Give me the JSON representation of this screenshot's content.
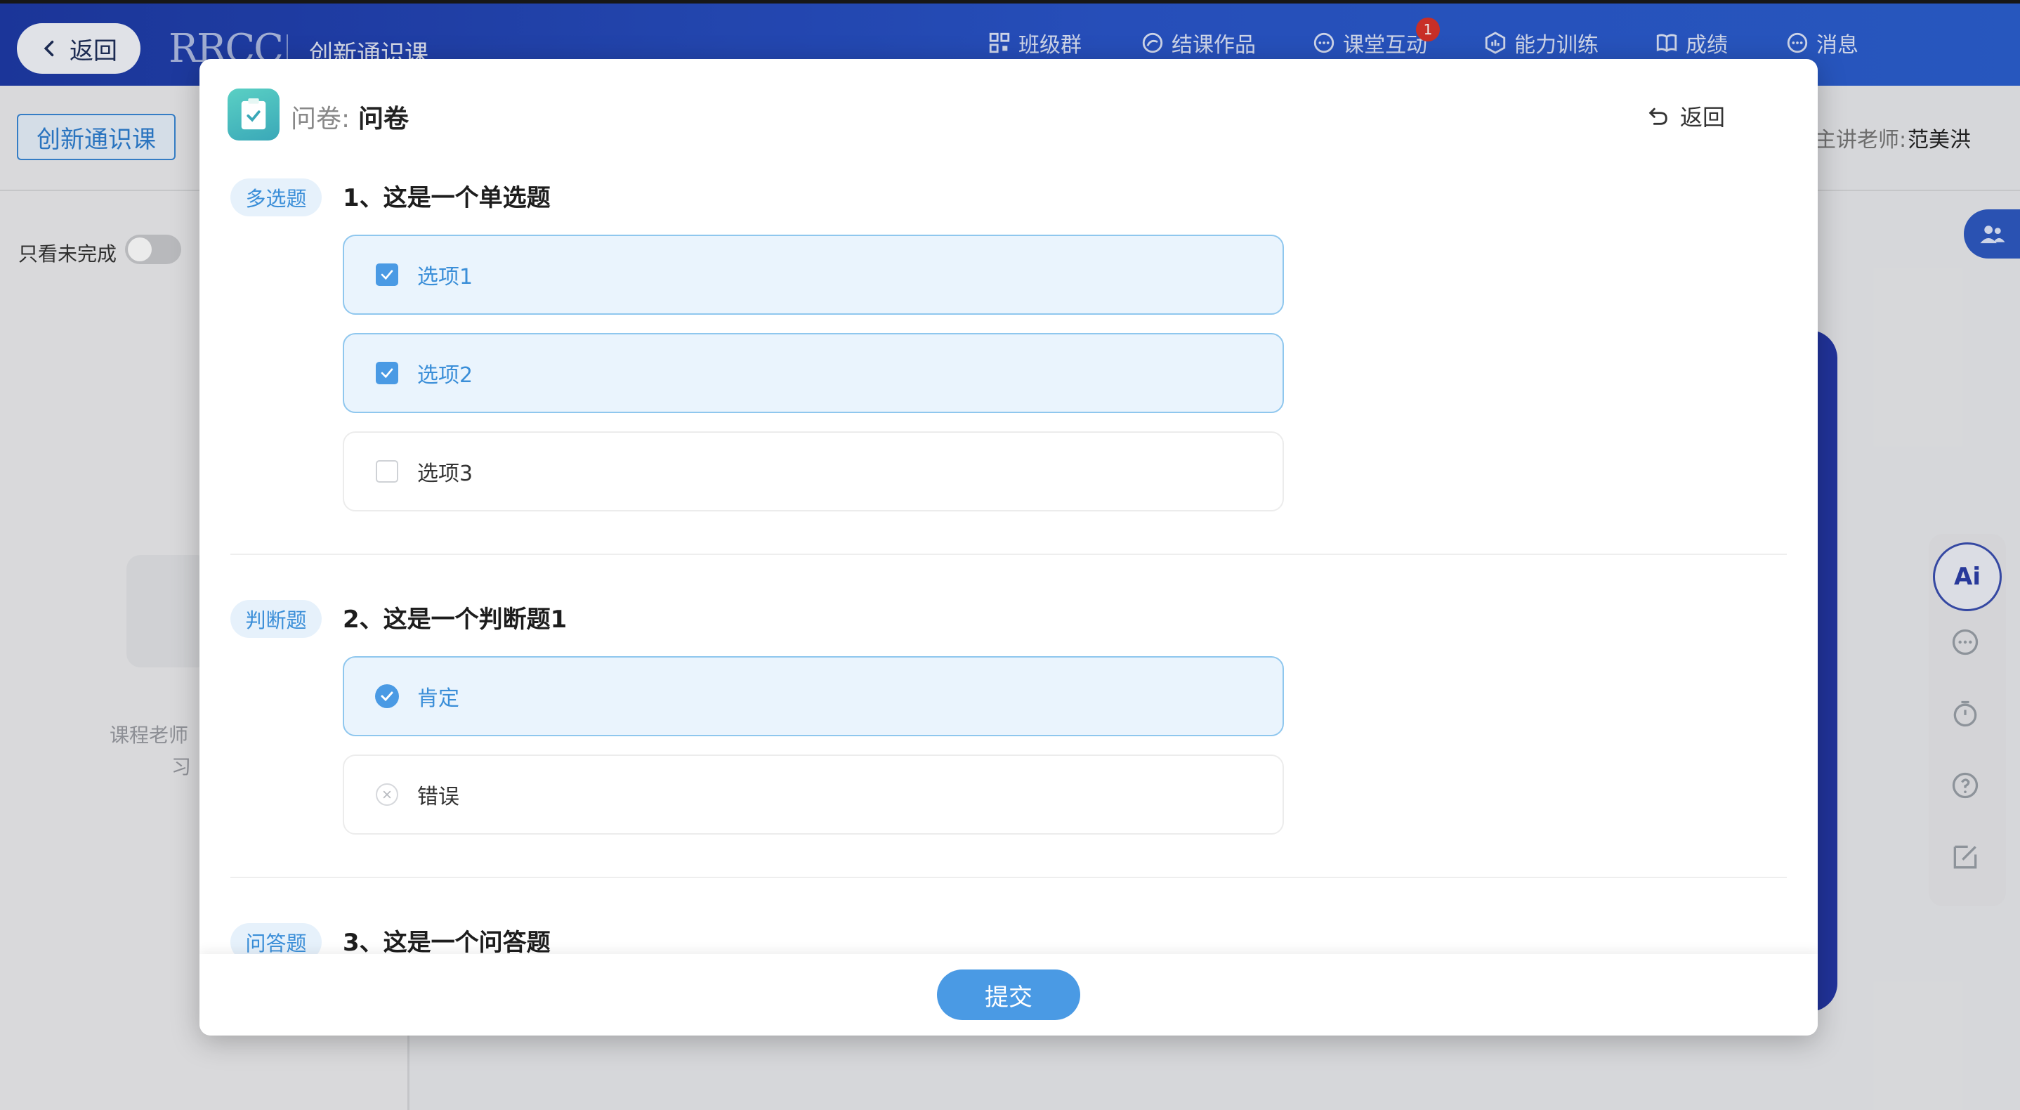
{
  "topbar": {
    "back_label": "返回",
    "logo_text": "RRCC",
    "course_name": "创新通识课",
    "nav": [
      {
        "label": "班级群",
        "icon": "qr-grid-icon"
      },
      {
        "label": "结课作品",
        "icon": "palette-icon"
      },
      {
        "label": "课堂互动",
        "icon": "chat-bubble-icon",
        "badge": "1"
      },
      {
        "label": "能力训练",
        "icon": "hexagon-chart-icon"
      },
      {
        "label": "成绩",
        "icon": "book-icon"
      },
      {
        "label": "消息",
        "icon": "message-icon"
      }
    ]
  },
  "background": {
    "course_chip": "创新通识课",
    "only_unfinished": "只看未完成",
    "hint_line1": "课程老师",
    "hint_line2": "习",
    "teacher_label": "主讲老师:",
    "teacher_name": "范美洪",
    "ai_label": "Ai"
  },
  "modal": {
    "header_label": "问卷:",
    "header_title": "问卷",
    "back_label": "返回",
    "questions": [
      {
        "type": "多选题",
        "title": "1、这是一个单选题",
        "options": [
          {
            "label": "选项1",
            "selected": true
          },
          {
            "label": "选项2",
            "selected": true
          },
          {
            "label": "选项3",
            "selected": false
          }
        ]
      },
      {
        "type": "判断题",
        "title": "2、这是一个判断题1",
        "options": [
          {
            "label": "肯定",
            "selected": true
          },
          {
            "label": "错误",
            "selected": false
          }
        ]
      },
      {
        "type": "问答题",
        "title": "3、这是一个问答题"
      }
    ],
    "submit_label": "提交"
  },
  "colors": {
    "accent": "#4a9ae4",
    "topbar": "#2a55c9",
    "selected_bg": "#eaf4fd"
  }
}
